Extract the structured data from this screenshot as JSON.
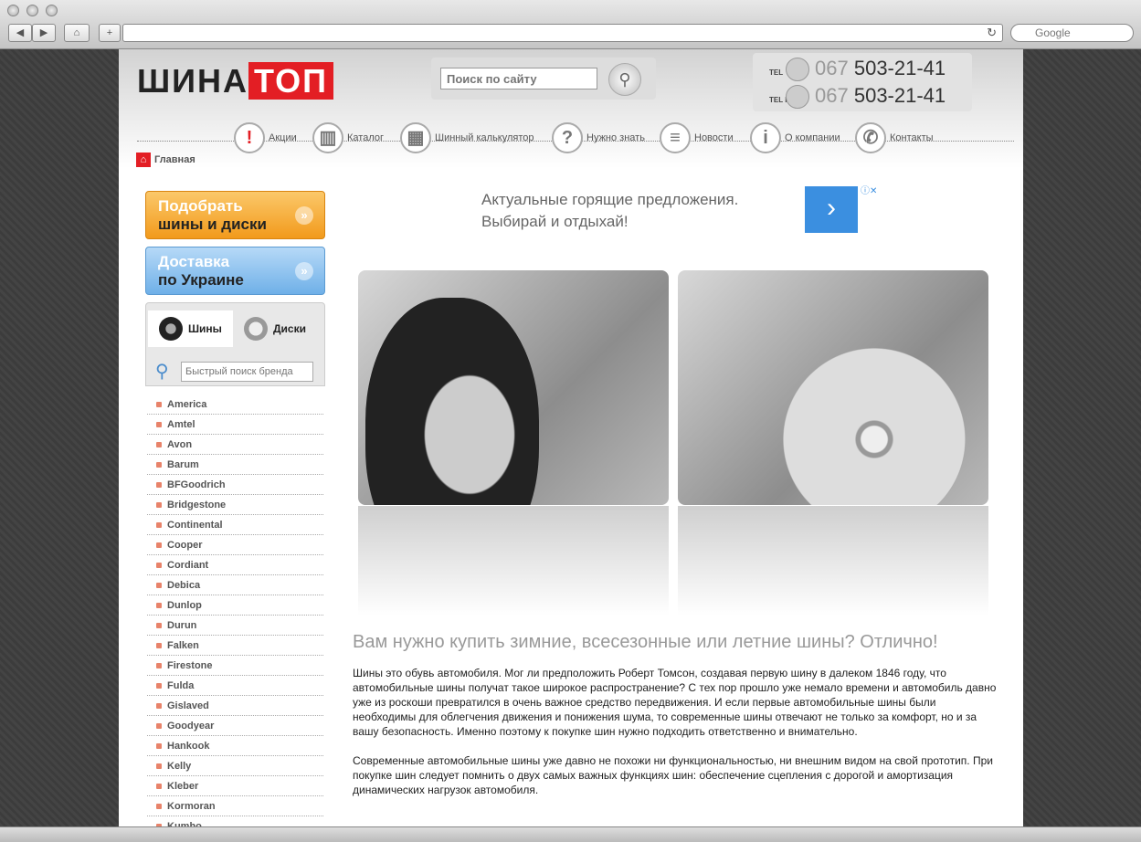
{
  "browser": {
    "search_placeholder": "Google",
    "back": "◀",
    "forward": "▶",
    "home": "⌂",
    "add": "+",
    "reload": "↻"
  },
  "header": {
    "logo_part1": "ШИНА",
    "logo_part2": "ТОП",
    "search_placeholder": "Поиск по сайту",
    "phones": [
      {
        "label": "TEL",
        "code": "067",
        "number": "503-21-41"
      },
      {
        "label": "TEL FAX",
        "code": "067",
        "number": "503-21-41"
      }
    ]
  },
  "nav": [
    {
      "label": "Акции",
      "icon": "!"
    },
    {
      "label": "Каталог",
      "icon": "▥"
    },
    {
      "label": "Шинный калькулятор",
      "icon": "▦"
    },
    {
      "label": "Нужно знать",
      "icon": "?"
    },
    {
      "label": "Новости",
      "icon": "≡"
    },
    {
      "label": "О компании",
      "icon": "i"
    },
    {
      "label": "Контакты",
      "icon": "✆"
    }
  ],
  "breadcrumb": "Главная",
  "sidebar": {
    "pick_btn": {
      "line1": "Подобрать",
      "line2": "шины и диски"
    },
    "delivery_btn": {
      "line1": "Доставка",
      "line2": "по Украине"
    },
    "tabs": [
      "Шины",
      "Диски"
    ],
    "brand_search_placeholder": "Быстрый поиск бренда",
    "brands": [
      "America",
      "Amtel",
      "Avon",
      "Barum",
      "BFGoodrich",
      "Bridgestone",
      "Continental",
      "Cooper",
      "Cordiant",
      "Debica",
      "Dunlop",
      "Durun",
      "Falken",
      "Firestone",
      "Fulda",
      "Gislaved",
      "Goodyear",
      "Hankook",
      "Kelly",
      "Kleber",
      "Kormoran",
      "Kumho"
    ]
  },
  "ad": {
    "line1": "Актуальные горящие предложения.",
    "line2": "Выбирай и отдыхай!",
    "button": "›"
  },
  "main": {
    "title": "Вам нужно купить зимние, всесезонные или летние шины? Отлично!",
    "paragraphs": [
      "Шины это обувь автомобиля. Мог ли предположить Роберт Томсон, создавая первую шину в далеком 1846 году, что автомобильные шины получат такое широкое распространение? С тех пор прошло уже немало времени и автомобиль давно уже из роскоши превратился в очень важное средство передвижения. И если первые автомобильные шины были необходимы для облегчения движения и понижения шума, то современные шины отвечают не только за комфорт, но и за вашу безопасность. Именно поэтому к покупке шин нужно подходить ответственно и внимательно.",
      "Современные автомобильные шины уже давно не похожи ни функциональностью, ни внешним видом на свой прототип. При покупке шин следует помнить о двух самых важных функциях шин: обеспечение сцепления с дорогой и амортизация динамических нагрузок автомобиля."
    ]
  },
  "colors": {
    "brand_red": "#e31e24",
    "orange": "#f5a623",
    "blue": "#6fb0e8"
  }
}
